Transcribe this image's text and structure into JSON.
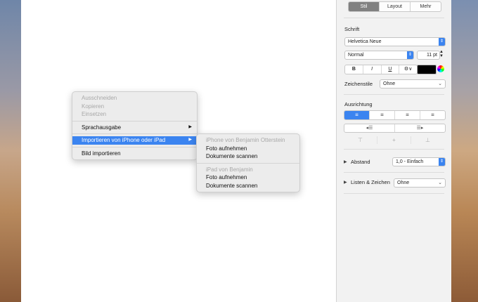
{
  "inspector": {
    "tabs": [
      "Stil",
      "Layout",
      "Mehr"
    ],
    "font_section": "Schrift",
    "font_family": "Helvetica Neue",
    "font_style": "Normal",
    "font_size": "11 pt",
    "format_buttons": [
      "B",
      "I",
      "U",
      "⚙∨"
    ],
    "char_styles_label": "Zeichenstile",
    "char_styles_value": "Ohne",
    "alignment_section": "Ausrichtung",
    "align_buttons": [
      "≡",
      "≡",
      "≡",
      "≡"
    ],
    "indent_buttons": [
      "◂☰",
      "☰▸"
    ],
    "valign_buttons": [
      "⊤",
      "+",
      "⊥"
    ],
    "spacing_label": "Abstand",
    "spacing_value": "1,0 - Einfach",
    "lists_label": "Listen & Zeichen",
    "lists_value": "Ohne"
  },
  "context_menu": {
    "items": [
      {
        "label": "Ausschneiden",
        "disabled": true
      },
      {
        "label": "Kopieren",
        "disabled": true
      },
      {
        "label": "Einsetzen",
        "disabled": true
      },
      {
        "label": "Sprachausgabe",
        "submenu": true
      },
      {
        "label": "Importieren von iPhone oder iPad",
        "submenu": true,
        "highlighted": true
      },
      {
        "label": "Bild importieren"
      }
    ]
  },
  "submenu": {
    "device1_header": "iPhone von Benjamin Otterstein",
    "device1_items": [
      "Foto aufnehmen",
      "Dokumente scannen"
    ],
    "device2_header": "iPad von Benjamin",
    "device2_items": [
      "Foto aufnehmen",
      "Dokumente scannen"
    ]
  },
  "colors": {
    "accent": "#3b84f0",
    "text_color_well": "#000000"
  }
}
